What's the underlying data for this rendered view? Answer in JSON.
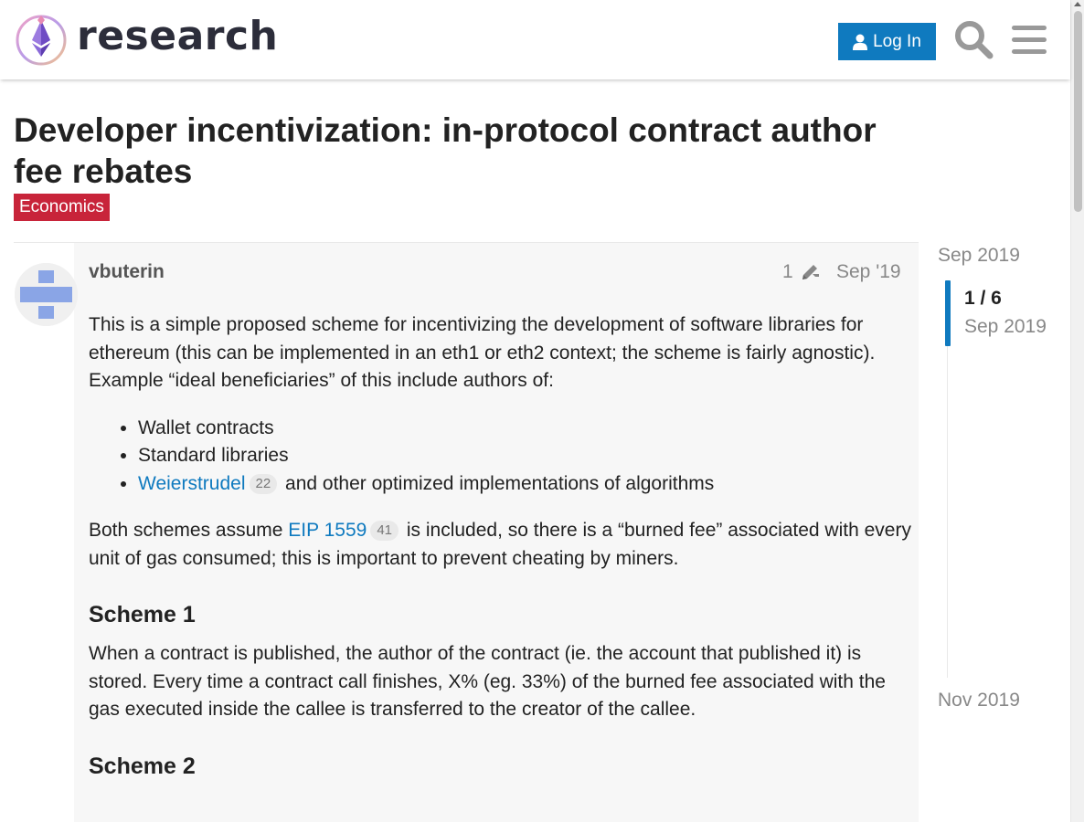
{
  "header": {
    "logo_text": "research",
    "login_label": "Log In",
    "search_icon": "search-icon",
    "menu_icon": "hamburger-menu-icon",
    "accent_color": "#0f7abf"
  },
  "topic": {
    "title": "Developer incentivization: in-protocol contract author fee rebates",
    "category": "Economics",
    "category_color": "#c8243a"
  },
  "post": {
    "username": "vbuterin",
    "edit_count": "1",
    "date": "Sep '19",
    "intro": "This is a simple proposed scheme for incentivizing the development of software libraries for ethereum (this can be implemented in an eth1 or eth2 context; the scheme is fairly agnostic). Example “ideal beneficiaries” of this include authors of:",
    "list": {
      "item1": "Wallet contracts",
      "item2": "Standard libraries",
      "item3_link": "Weierstrudel",
      "item3_clicks": "22",
      "item3_rest": "and other optimized implementations of algorithms"
    },
    "para2": {
      "before": "Both schemes assume",
      "link": "EIP 1559",
      "clicks": "41",
      "after": "is included, so there is a “burned fee” associated with every unit of gas consumed; this is important to prevent cheating by miners."
    },
    "scheme1_heading": "Scheme 1",
    "scheme1_text": "When a contract is published, the author of the contract (ie. the account that published it) is stored. Every time a contract call finishes, X% (eg. 33%) of the burned fee associated with the gas executed inside the callee is transferred to the creator of the callee.",
    "scheme2_heading": "Scheme 2"
  },
  "timeline": {
    "start": "Sep 2019",
    "position": "1 / 6",
    "current_date": "Sep 2019",
    "end": "Nov 2019"
  }
}
